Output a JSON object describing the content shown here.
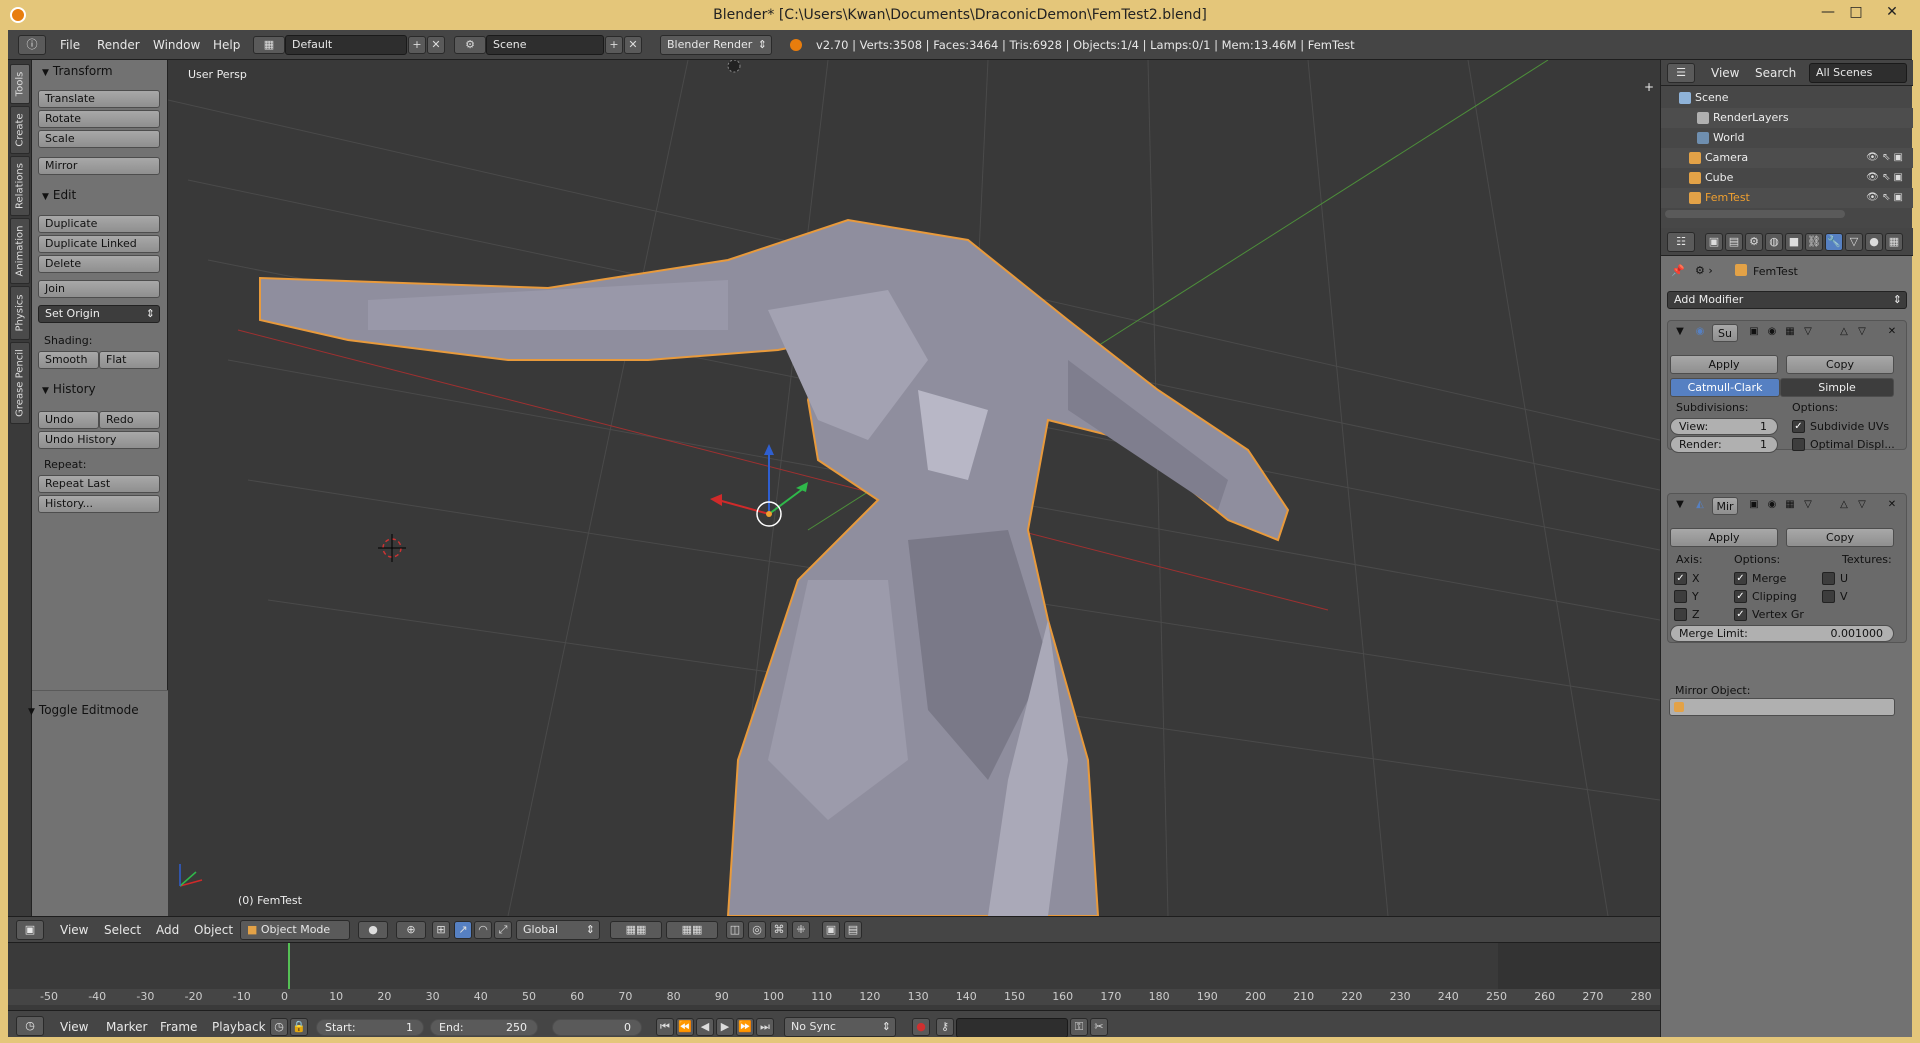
{
  "window": {
    "title": "Blender* [C:\\Users\\Kwan\\Documents\\DraconicDemon\\FemTest2.blend]",
    "minimize": "—",
    "maximize": "□",
    "close": "✕"
  },
  "info_header": {
    "menus": [
      "File",
      "Render",
      "Window",
      "Help"
    ],
    "layout": "Default",
    "scene": "Scene",
    "engine": "Blender Render",
    "stats": "v2.70 | Verts:3508 | Faces:3464 | Tris:6928 | Objects:1/4 | Lamps:0/1 | Mem:13.46M | FemTest"
  },
  "vertical_tabs": [
    "Tools",
    "Create",
    "Relations",
    "Animation",
    "Physics",
    "Grease Pencil"
  ],
  "tool_shelf": {
    "transform": {
      "title": "Transform",
      "buttons": [
        "Translate",
        "Rotate",
        "Scale",
        "Mirror"
      ]
    },
    "edit": {
      "title": "Edit",
      "buttons": [
        "Duplicate",
        "Duplicate Linked",
        "Delete",
        "Join"
      ],
      "set_origin": "Set Origin",
      "shading_label": "Shading:",
      "smooth": "Smooth",
      "flat": "Flat"
    },
    "history": {
      "title": "History",
      "undo": "Undo",
      "redo": "Redo",
      "undo_history": "Undo History",
      "repeat_label": "Repeat:",
      "repeat_last": "Repeat Last",
      "history_btn": "History..."
    },
    "toggle_editmode": "Toggle Editmode"
  },
  "viewport": {
    "view_label": "User Persp",
    "object_label": "(0) FemTest"
  },
  "view3d_header": {
    "menus": [
      "View",
      "Select",
      "Add",
      "Object"
    ],
    "mode": "Object Mode",
    "orientation": "Global"
  },
  "timeline": {
    "ticks": [
      "-50",
      "-40",
      "-30",
      "-20",
      "-10",
      "0",
      "10",
      "20",
      "30",
      "40",
      "50",
      "60",
      "70",
      "80",
      "90",
      "100",
      "110",
      "120",
      "130",
      "140",
      "150",
      "160",
      "170",
      "180",
      "190",
      "200",
      "210",
      "220",
      "230",
      "240",
      "250",
      "260",
      "270",
      "280"
    ],
    "current_frame": 0,
    "menus": [
      "View",
      "Marker",
      "Frame",
      "Playback"
    ],
    "start": "Start:",
    "start_val": "1",
    "end": "End:",
    "end_val": "250",
    "frame_val": "0",
    "sync": "No Sync"
  },
  "outliner": {
    "view": "View",
    "search": "Search",
    "filter": "All Scenes",
    "rows": [
      {
        "label": "Scene",
        "icon_color": "#8fb3d9"
      },
      {
        "label": "RenderLayers",
        "icon_color": "#b0b0b0"
      },
      {
        "label": "World",
        "icon_color": "#6f8fb0"
      },
      {
        "label": "Camera",
        "icon_color": "#e3a247"
      },
      {
        "label": "Cube",
        "icon_color": "#e3a247"
      },
      {
        "label": "FemTest",
        "icon_color": "#e3a247"
      }
    ]
  },
  "properties": {
    "object_name": "FemTest",
    "add_modifier": "Add Modifier",
    "subsurf": {
      "name": "Su",
      "apply": "Apply",
      "copy": "Copy",
      "catmull": "Catmull-Clark",
      "simple": "Simple",
      "subdivisions": "Subdivisions:",
      "options": "Options:",
      "view": "View:",
      "view_val": "1",
      "render": "Render:",
      "render_val": "1",
      "subdivide_uvs": "Subdivide UVs",
      "optimal_display": "Optimal Displ..."
    },
    "mirror": {
      "name": "Mir",
      "apply": "Apply",
      "copy": "Copy",
      "axis": "Axis:",
      "options": "Options:",
      "textures": "Textures:",
      "x": "X",
      "y": "Y",
      "z": "Z",
      "merge": "Merge",
      "clipping": "Clipping",
      "vertex_gr": "Vertex Gr",
      "u": "U",
      "v": "V",
      "merge_limit": "Merge Limit:",
      "merge_limit_val": "0.001000",
      "mirror_object": "Mirror Object:"
    }
  },
  "colors": {
    "frame": "#e4c67a",
    "accent_blue": "#5680c2",
    "selection_orange": "#f0a030"
  }
}
